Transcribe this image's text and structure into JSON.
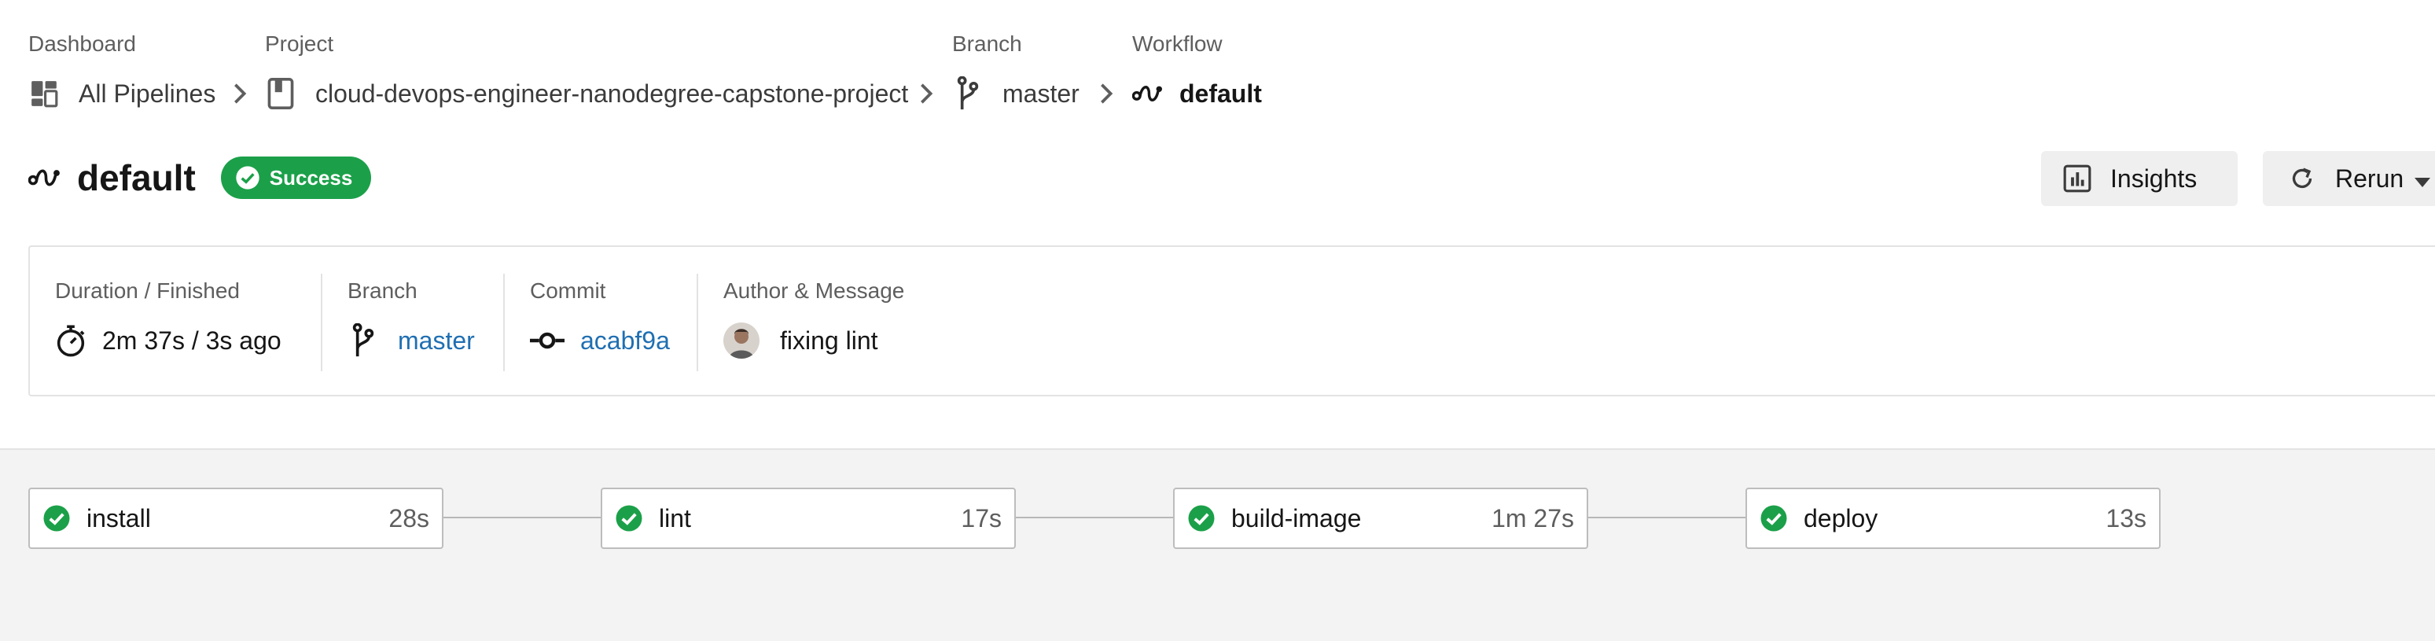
{
  "breadcrumb": {
    "dashboard": {
      "label": "Dashboard",
      "value": "All Pipelines",
      "icon": "dashboard-icon"
    },
    "project": {
      "label": "Project",
      "value": "cloud-devops-engineer-nanodegree-capstone-project",
      "icon": "project-icon"
    },
    "branch": {
      "label": "Branch",
      "value": "master",
      "icon": "branch-icon"
    },
    "workflow": {
      "label": "Workflow",
      "value": "default",
      "icon": "workflow-icon"
    }
  },
  "header": {
    "title": "default",
    "status": "Success",
    "status_color": "#1ba049",
    "insights_label": "Insights",
    "rerun_label": "Rerun"
  },
  "meta": {
    "duration_label": "Duration / Finished",
    "duration_value": "2m 37s / 3s ago",
    "branch_label": "Branch",
    "branch_value": "master",
    "commit_label": "Commit",
    "commit_value": "acabf9a",
    "author_label": "Author & Message",
    "message": "fixing lint"
  },
  "jobs": [
    {
      "name": "install",
      "duration": "28s",
      "status": "success"
    },
    {
      "name": "lint",
      "duration": "17s",
      "status": "success"
    },
    {
      "name": "build-image",
      "duration": "1m 27s",
      "status": "success"
    },
    {
      "name": "deploy",
      "duration": "13s",
      "status": "success"
    }
  ],
  "colors": {
    "success": "#1ba049",
    "link": "#1f6fb2"
  }
}
